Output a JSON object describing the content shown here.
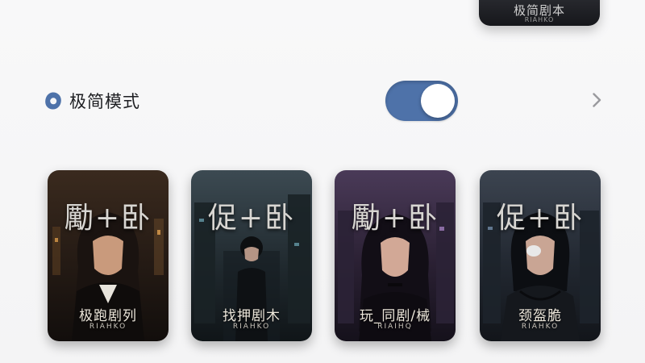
{
  "top_card": {
    "title": "极简剧本",
    "subtitle": "RIAHKO"
  },
  "setting": {
    "label": "极简模式",
    "toggle_on": true,
    "colors": {
      "accent": "#4e72a9",
      "icon": "#4e72a9",
      "chevron": "#9a9a9e"
    }
  },
  "cards": [
    {
      "logo": "勵+卧",
      "title": "极跑剧列",
      "subtitle": "RIAHKO",
      "theme": "amber"
    },
    {
      "logo": "促+卧",
      "title": "找押剧木",
      "subtitle": "RIAHKO",
      "theme": "teal"
    },
    {
      "logo": "勵+卧",
      "title": "玩_同剧/械",
      "subtitle": "RIAIHQ",
      "theme": "violet"
    },
    {
      "logo": "促+卧",
      "title": "颈盔脆",
      "subtitle": "RIAHKO",
      "theme": "slate"
    }
  ]
}
